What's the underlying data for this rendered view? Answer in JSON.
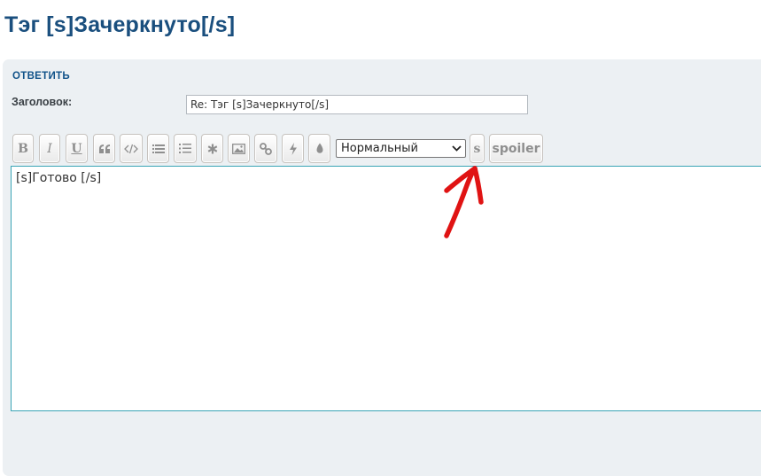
{
  "page": {
    "title": "Тэг [s]Зачеркнуто[/s]"
  },
  "reply": {
    "heading": "ОТВЕТИТЬ",
    "subject_label": "Заголовок:",
    "subject_value": "Re: Тэг [s]Зачеркнуто[/s]"
  },
  "toolbar": {
    "bold_label": "B",
    "italic_label": "I",
    "underline_label": "U",
    "icons": [
      "quote-icon",
      "code-icon",
      "bulleted-list-icon",
      "numbered-list-icon",
      "list-item-asterisk-icon",
      "image-icon",
      "link-icon",
      "flash-icon",
      "color-drop-icon"
    ],
    "font_size_selected": "Нормальный",
    "strike_label": "s",
    "spoiler_label": "spoiler"
  },
  "editor": {
    "text": "[s]Готово [/s]"
  },
  "colors": {
    "title": "#1a4f7e",
    "panel_bg": "#ecf0f3",
    "editor_border": "#3aa5b5",
    "annotation": "#e01313"
  }
}
